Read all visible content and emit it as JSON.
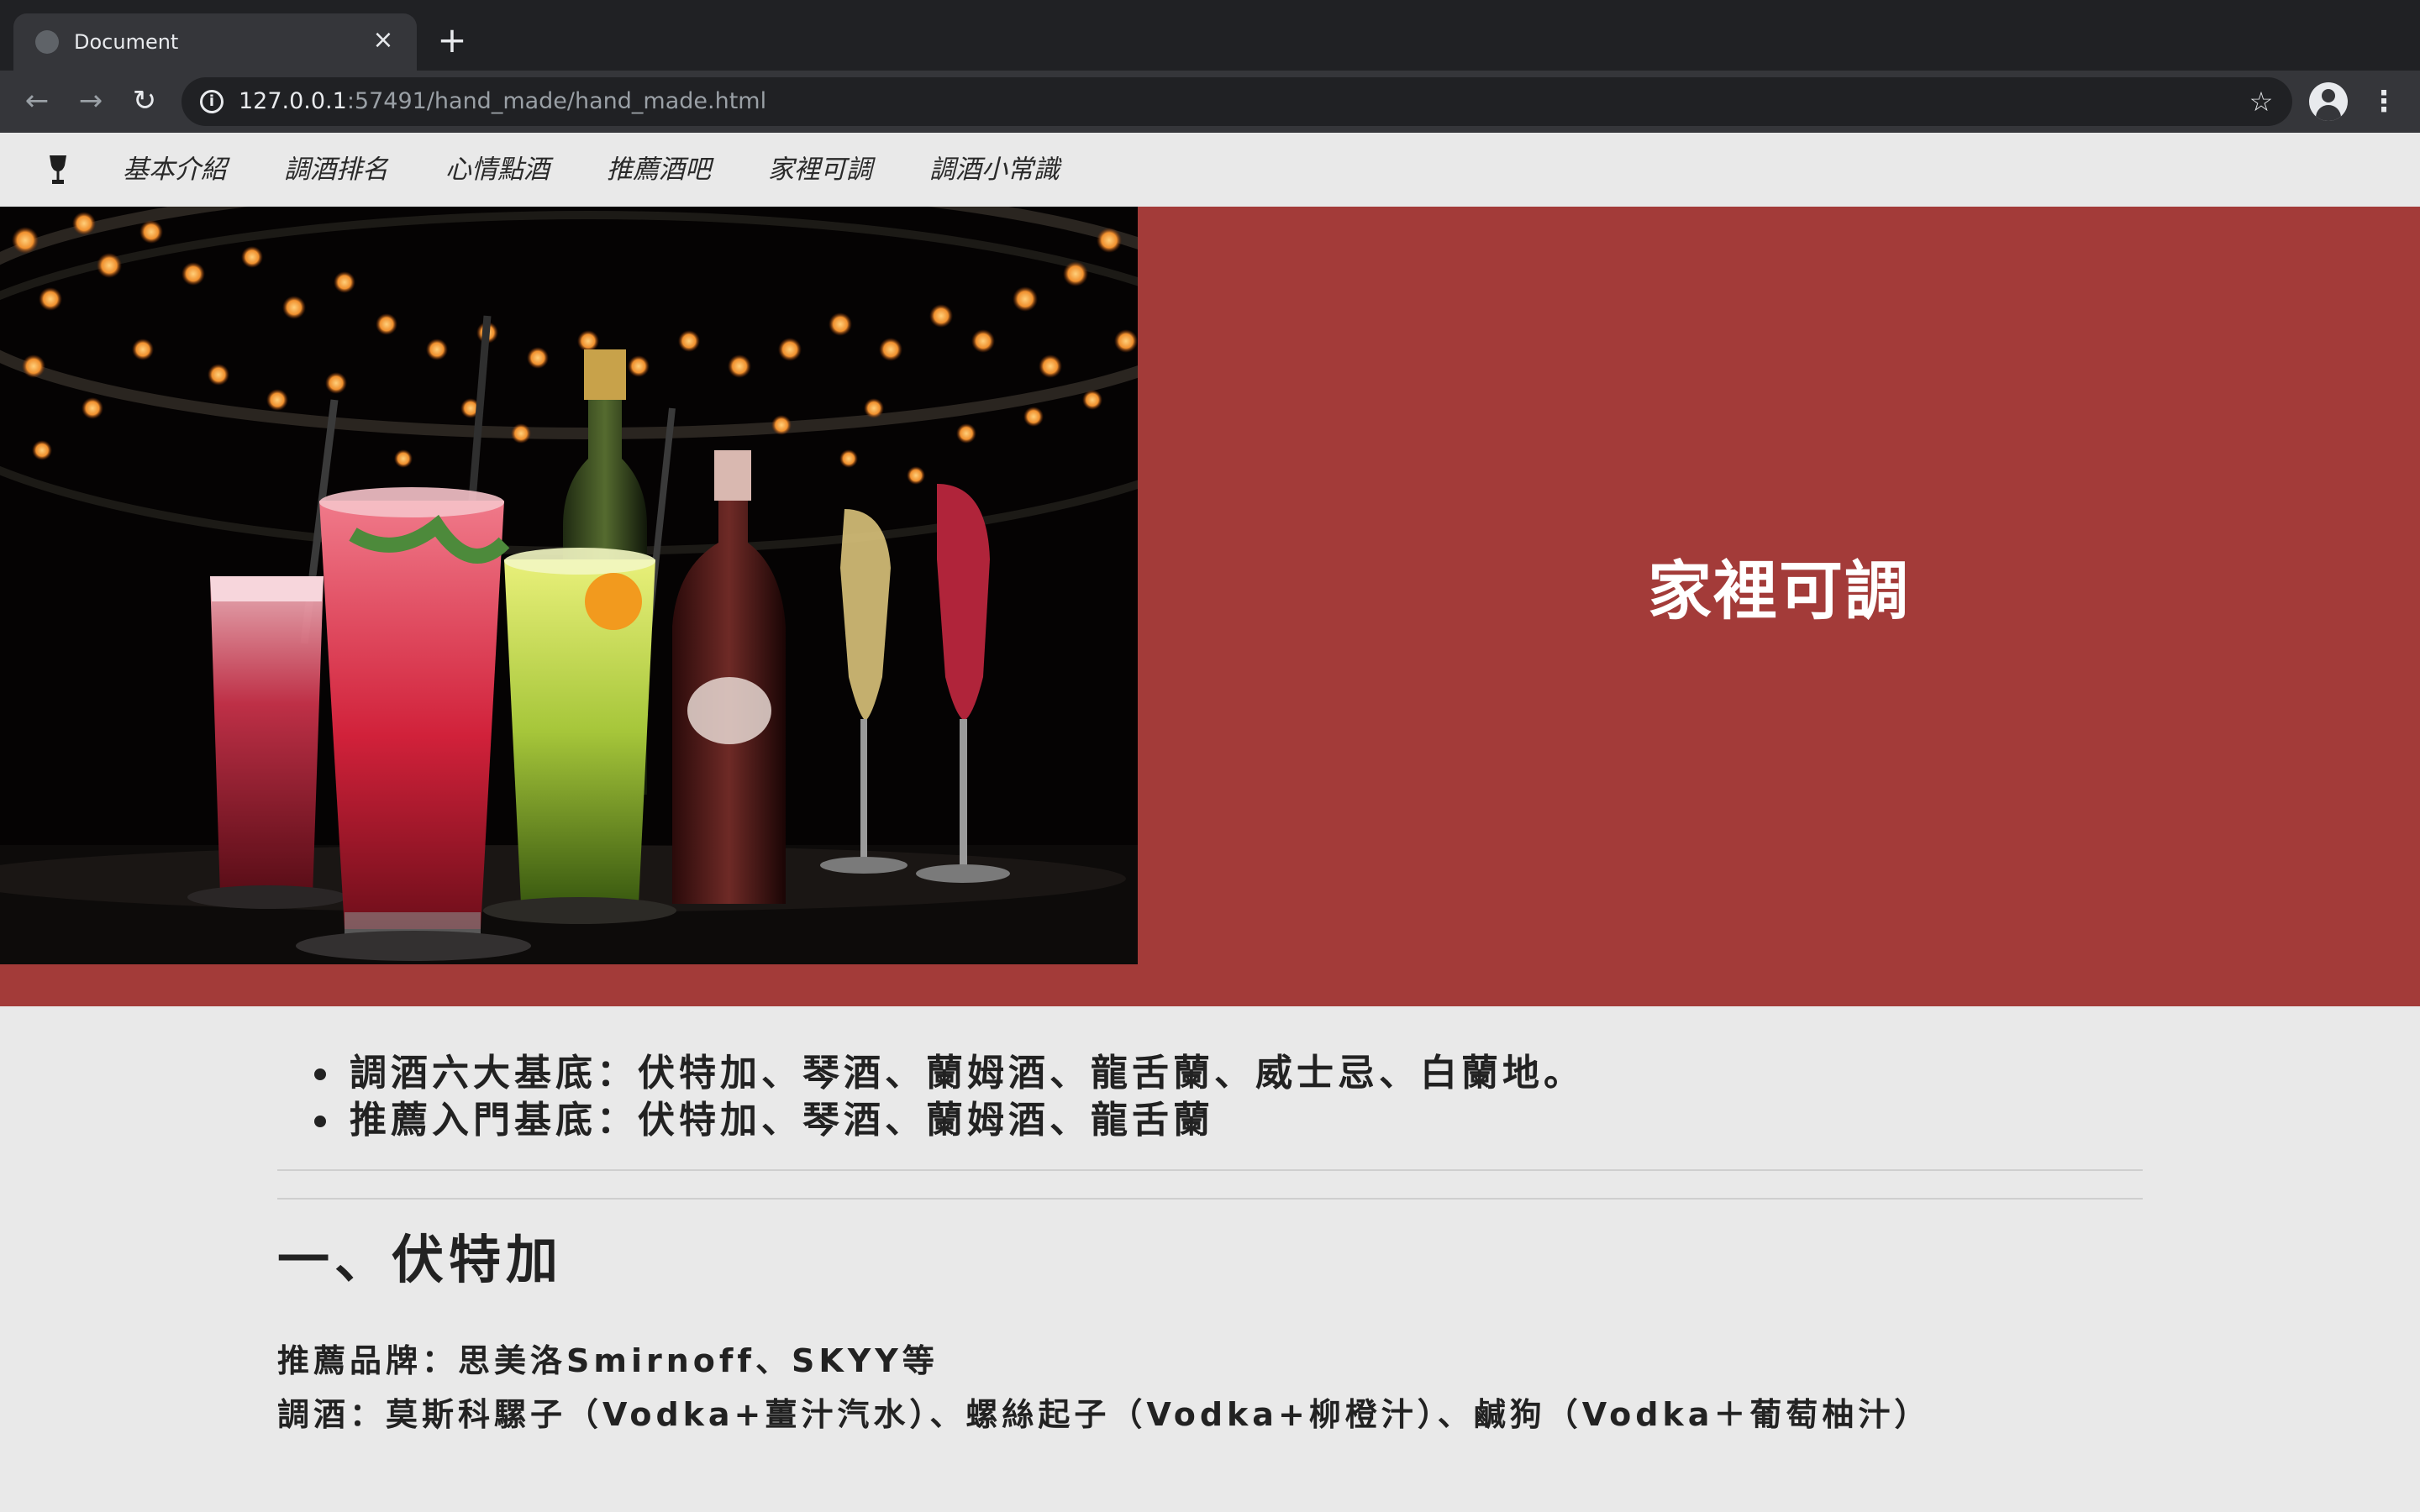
{
  "browser": {
    "tab_title": "Document",
    "url_host": "127.0.0.1",
    "url_rest": ":57491/hand_made/hand_made.html",
    "icons": [
      "globe-icon",
      "close-icon",
      "plus-icon",
      "arrow-left-icon",
      "arrow-right-icon",
      "reload-icon",
      "info-icon",
      "star-icon",
      "profile-icon",
      "kebab-menu-icon"
    ]
  },
  "site_nav": {
    "brand_icon": "wine-glass-icon",
    "links": [
      "基本介紹",
      "調酒排名",
      "心情點酒",
      "推薦酒吧",
      "家裡可調",
      "調酒小常識"
    ]
  },
  "hero": {
    "title": "家裡可調",
    "accent_color": "#a33b39"
  },
  "content": {
    "bullets": [
      "調酒六大基底：伏特加、琴酒、蘭姆酒、龍舌蘭、威士忌、白蘭地。",
      "推薦入門基底：伏特加、琴酒、蘭姆酒、龍舌蘭"
    ],
    "section_title": "一、伏特加",
    "brands_text": "推薦品牌：思美洛Smirnoff、SKYY等",
    "cocktails_text": "調酒：莫斯科騾子（Vodka+薑汁汽水）、螺絲起子（Vodka+柳橙汁）、鹹狗（Vodka＋葡萄柚汁）"
  }
}
